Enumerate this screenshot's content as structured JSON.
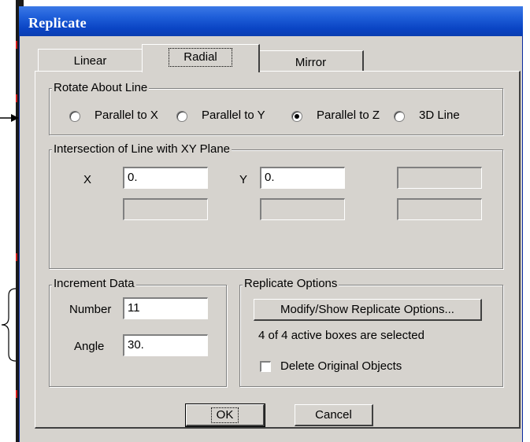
{
  "window": {
    "title": "Replicate"
  },
  "tabs": [
    {
      "label": "Linear"
    },
    {
      "label": "Radial"
    },
    {
      "label": "Mirror"
    }
  ],
  "active_tab": "Radial",
  "rotate_about_line": {
    "legend": "Rotate About Line",
    "options": [
      {
        "label": "Parallel to X",
        "selected": false
      },
      {
        "label": "Parallel to Y",
        "selected": false
      },
      {
        "label": "Parallel to Z",
        "selected": true
      },
      {
        "label": "3D Line",
        "selected": false
      }
    ]
  },
  "intersection": {
    "legend": "Intersection of Line with XY Plane",
    "x_label": "X",
    "x_value": "0.",
    "y_label": "Y",
    "y_value": "0."
  },
  "increment_data": {
    "legend": "Increment Data",
    "number_label": "Number",
    "number_value": "11",
    "angle_label": "Angle",
    "angle_value": "30."
  },
  "replicate_options": {
    "legend": "Replicate Options",
    "modify_button": "Modify/Show Replicate Options...",
    "status": "4 of 4 active boxes are selected",
    "delete_label": "Delete Original Objects",
    "delete_checked": false
  },
  "buttons": {
    "ok": "OK",
    "cancel": "Cancel"
  },
  "colors": {
    "titlebar": "#0a44c4",
    "dialog_bg": "#d6d3ce"
  }
}
